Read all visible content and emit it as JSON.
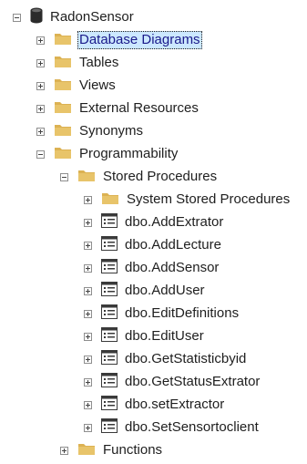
{
  "tree": {
    "root": {
      "label": "RadonSensor",
      "icon": "database-icon",
      "expanded": true
    },
    "items": [
      {
        "label": "Database Diagrams",
        "icon": "folder-icon",
        "expanded": false,
        "selected": true
      },
      {
        "label": "Tables",
        "icon": "folder-icon",
        "expanded": false
      },
      {
        "label": "Views",
        "icon": "folder-icon",
        "expanded": false
      },
      {
        "label": "External Resources",
        "icon": "folder-icon",
        "expanded": false
      },
      {
        "label": "Synonyms",
        "icon": "folder-icon",
        "expanded": false
      },
      {
        "label": "Programmability",
        "icon": "folder-icon",
        "expanded": true,
        "children": [
          {
            "label": "Stored Procedures",
            "icon": "folder-icon",
            "expanded": true,
            "children": [
              {
                "label": "System Stored Procedures",
                "icon": "folder-icon",
                "expanded": false
              },
              {
                "label": "dbo.AddExtrator",
                "icon": "stored-procedure-icon",
                "expanded": false
              },
              {
                "label": "dbo.AddLecture",
                "icon": "stored-procedure-icon",
                "expanded": false
              },
              {
                "label": "dbo.AddSensor",
                "icon": "stored-procedure-icon",
                "expanded": false
              },
              {
                "label": "dbo.AddUser",
                "icon": "stored-procedure-icon",
                "expanded": false
              },
              {
                "label": "dbo.EditDefinitions",
                "icon": "stored-procedure-icon",
                "expanded": false
              },
              {
                "label": "dbo.EditUser",
                "icon": "stored-procedure-icon",
                "expanded": false
              },
              {
                "label": "dbo.GetStatisticbyid",
                "icon": "stored-procedure-icon",
                "expanded": false
              },
              {
                "label": "dbo.GetStatusExtrator",
                "icon": "stored-procedure-icon",
                "expanded": false
              },
              {
                "label": "dbo.setExtractor",
                "icon": "stored-procedure-icon",
                "expanded": false
              },
              {
                "label": "dbo.SetSensortoclient",
                "icon": "stored-procedure-icon",
                "expanded": false
              }
            ]
          },
          {
            "label": "Functions",
            "icon": "folder-icon",
            "expanded": false
          }
        ]
      }
    ]
  },
  "colors": {
    "folder": "#dcb253",
    "selection": "#cce8ff",
    "database": "#2b2b2b"
  }
}
